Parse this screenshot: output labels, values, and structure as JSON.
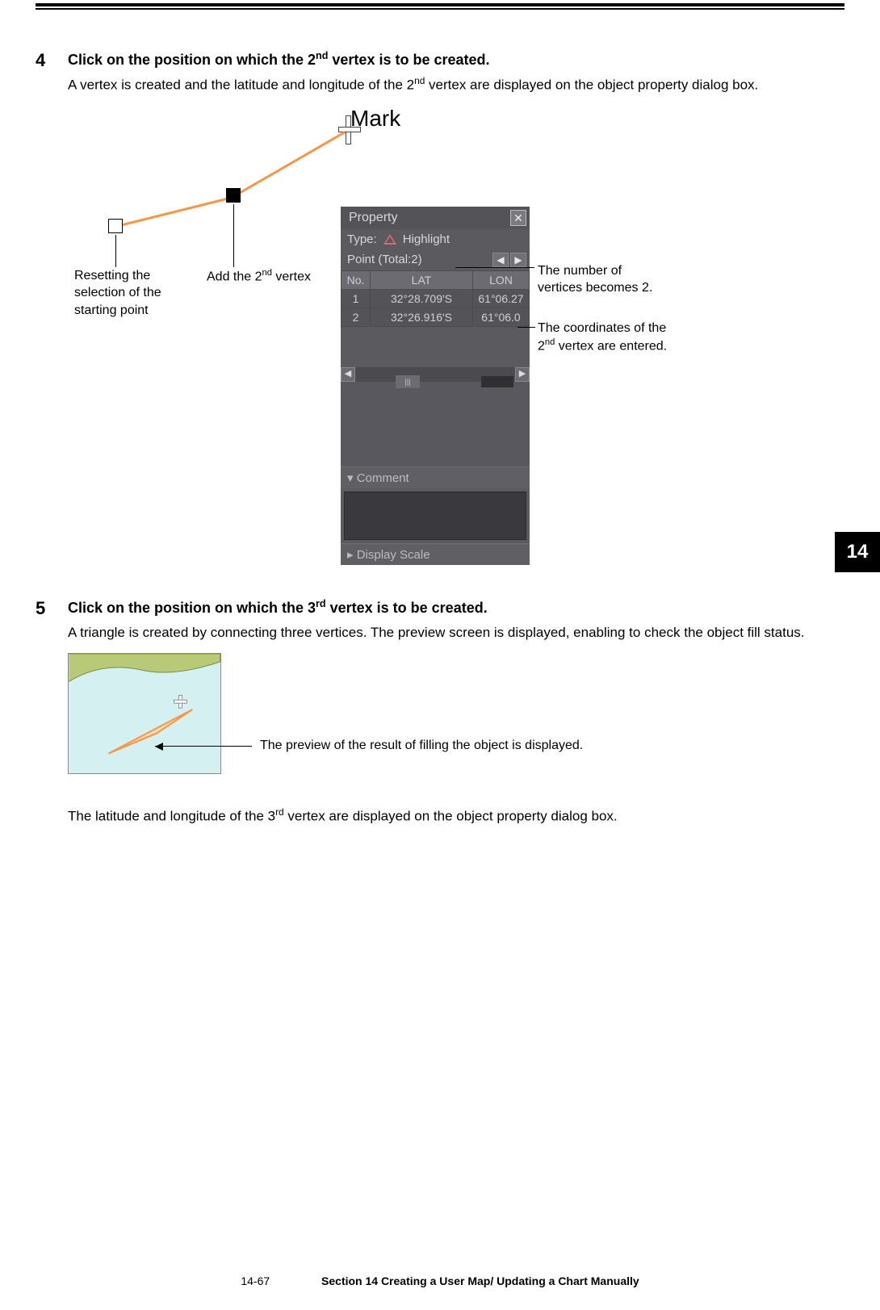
{
  "header": {},
  "page_tab": "14",
  "steps": [
    {
      "num": "4",
      "title_parts": [
        "Click on the position on which the 2",
        "nd",
        " vertex is to be created."
      ],
      "desc_parts": [
        "A vertex is created and the latitude and longitude of the 2",
        "nd",
        " vertex are displayed on the object property dialog box."
      ]
    },
    {
      "num": "5",
      "title_parts": [
        "Click on the position on which the 3",
        "rd",
        " vertex is to be created."
      ],
      "desc_parts": [
        "A triangle is created by connecting three vertices. The preview screen is displayed, enabling to check the object fill status."
      ]
    }
  ],
  "figure1": {
    "mark_label": "Mark",
    "callouts": {
      "reset": "Resetting the selection of the starting point",
      "add_parts": [
        "Add the 2",
        "nd",
        " vertex"
      ],
      "right1": "The number of vertices becomes 2.",
      "right2_parts": [
        "The coordinates of the 2",
        "nd",
        " vertex are entered."
      ]
    },
    "dialog": {
      "title": "Property",
      "type_label": "Type:",
      "type_value": "Highlight",
      "point_label": "Point",
      "total_label": "(Total:2)",
      "headers": [
        "No.",
        "LAT",
        "LON"
      ],
      "rows": [
        {
          "no": "1",
          "lat": "32°28.709'S",
          "lon": "61°06.27"
        },
        {
          "no": "2",
          "lat": "32°26.916'S",
          "lon": "61°06.0"
        }
      ],
      "comment_header": "▾ Comment",
      "scale_header": "▸ Display Scale"
    }
  },
  "figure2": {
    "annotation": "The preview of the result of filling the object is displayed."
  },
  "after_fig_parts": [
    "The latitude and longitude of the 3",
    "rd",
    " vertex are displayed on the object property dialog box."
  ],
  "footer": {
    "page": "14-67",
    "section": "Section 14    Creating a User Map/ Updating a Chart Manually"
  }
}
